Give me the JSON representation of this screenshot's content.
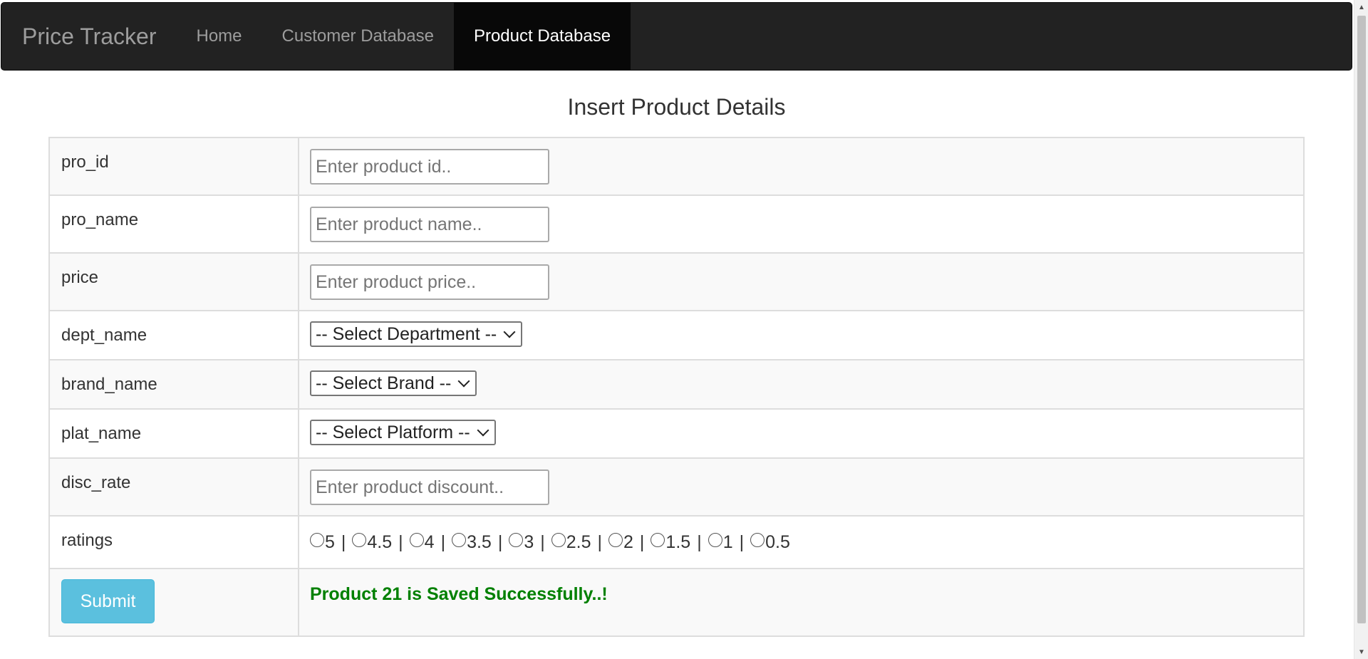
{
  "navbar": {
    "brand": "Price Tracker",
    "links": [
      {
        "label": "Home",
        "active": false
      },
      {
        "label": "Customer Database",
        "active": false
      },
      {
        "label": "Product Database",
        "active": true
      }
    ]
  },
  "form": {
    "title": "Insert Product Details",
    "fields": {
      "pro_id": {
        "label": "pro_id",
        "placeholder": "Enter product id..",
        "value": ""
      },
      "pro_name": {
        "label": "pro_name",
        "placeholder": "Enter product name..",
        "value": ""
      },
      "price": {
        "label": "price",
        "placeholder": "Enter product price..",
        "value": ""
      },
      "dept_name": {
        "label": "dept_name",
        "selected": "-- Select Department --"
      },
      "brand_name": {
        "label": "brand_name",
        "selected": "-- Select Brand --"
      },
      "plat_name": {
        "label": "plat_name",
        "selected": "-- Select Platform --"
      },
      "disc_rate": {
        "label": "disc_rate",
        "placeholder": "Enter product discount..",
        "value": ""
      },
      "ratings": {
        "label": "ratings",
        "options": [
          "5",
          "4.5",
          "4",
          "3.5",
          "3",
          "2.5",
          "2",
          "1.5",
          "1",
          "0.5"
        ],
        "separator": "|",
        "selected": null
      }
    },
    "submit_label": "Submit",
    "status_message": "Product 21 is Saved Successfully..!"
  },
  "colors": {
    "navbar_bg": "#222222",
    "nav_active_bg": "#080808",
    "submit_bg": "#5bc0de",
    "success_text": "#008000"
  }
}
